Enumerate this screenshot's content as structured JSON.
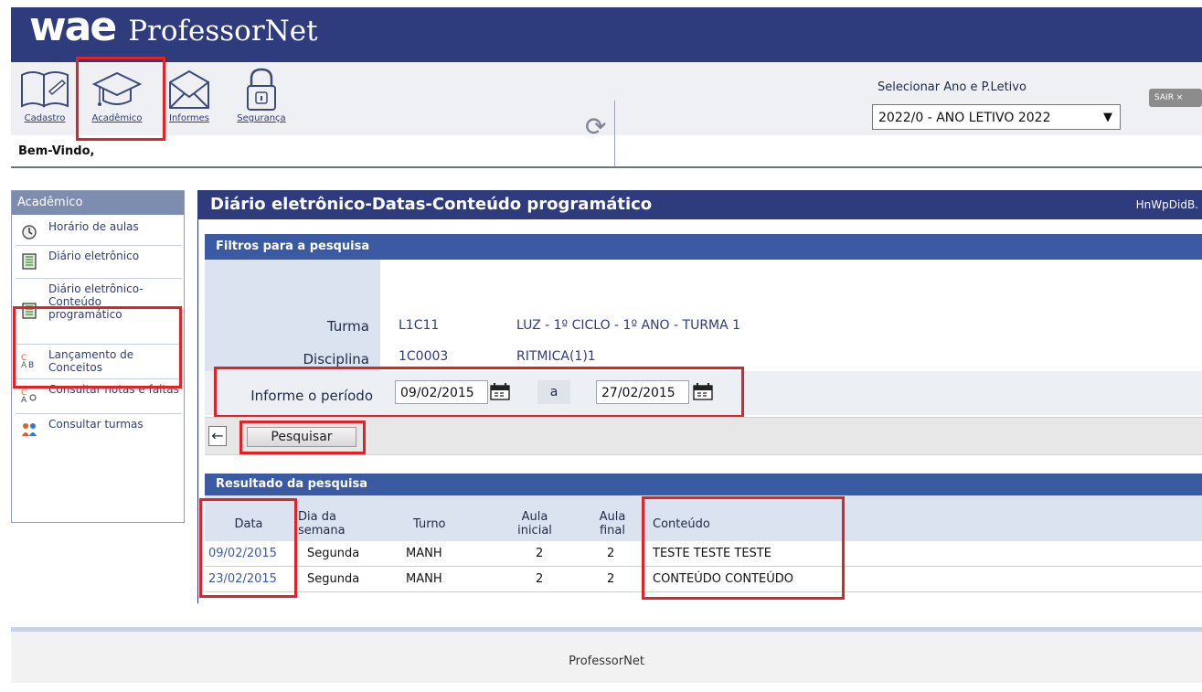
{
  "app": {
    "logo": "wae",
    "name": "ProfessorNet"
  },
  "toolbar": {
    "items": [
      {
        "label": "Cadastro",
        "icon": "book-icon"
      },
      {
        "label": "Acadêmico",
        "icon": "graduation-cap-icon"
      },
      {
        "label": "Informes",
        "icon": "envelope-icon"
      },
      {
        "label": "Segurança",
        "icon": "lock-icon"
      }
    ],
    "period_label": "Selecionar Ano e P.Letivo",
    "period_value": "2022/0 - ANO LETIVO 2022",
    "logout_label": "SAIR ×"
  },
  "welcome": "Bem-Vindo,",
  "sidebar": {
    "title": "Acadêmico",
    "items": [
      {
        "label": "Horário de aulas",
        "icon": "clock-icon"
      },
      {
        "label": "Diário eletrônico",
        "icon": "ledger-icon"
      },
      {
        "label": "Diário eletrônico-Conteúdo programático",
        "icon": "ledger-icon"
      },
      {
        "label": "Lançamento de Conceitos",
        "icon": "grades-icon"
      },
      {
        "label": "Consultar notas e faltas",
        "icon": "search-grades-icon"
      },
      {
        "label": "Consultar turmas",
        "icon": "people-icon"
      }
    ]
  },
  "main": {
    "title": "Diário eletrônico-Datas-Conteúdo programático",
    "page_code": "HnWpDidB."
  },
  "filters": {
    "header": "Filtros para a pesquisa",
    "turma_label": "Turma",
    "turma_code": "L1C11",
    "turma_desc": "LUZ - 1º CICLO - 1º ANO - TURMA 1",
    "disciplina_label": "Disciplina",
    "disciplina_code": "1C0003",
    "disciplina_desc": "RITMICA(1)1",
    "period_label": "Informe o período",
    "date_from": "09/02/2015",
    "sep": "a",
    "date_to": "27/02/2015"
  },
  "actions": {
    "search_label": "Pesquisar",
    "back_label": "←"
  },
  "results": {
    "header": "Resultado da pesquisa",
    "columns": {
      "data": "Data",
      "dia": [
        "Dia da",
        "semana"
      ],
      "turno": "Turno",
      "inicial": [
        "Aula",
        "inicial"
      ],
      "final": [
        "Aula",
        "final"
      ],
      "conteudo": "Conteúdo"
    },
    "rows": [
      {
        "data": "09/02/2015",
        "dia": "Segunda",
        "turno": "MANH",
        "inicial": "2",
        "final": "2",
        "conteudo": "TESTE TESTE TESTE"
      },
      {
        "data": "23/02/2015",
        "dia": "Segunda",
        "turno": "MANH",
        "inicial": "2",
        "final": "2",
        "conteudo": "CONTEÚDO CONTEÚDO"
      }
    ]
  },
  "footer": "ProfessorNet",
  "colors": {
    "brand": "#2e3c7e",
    "highlight": "#e32227",
    "section": "#3b5aa4"
  }
}
